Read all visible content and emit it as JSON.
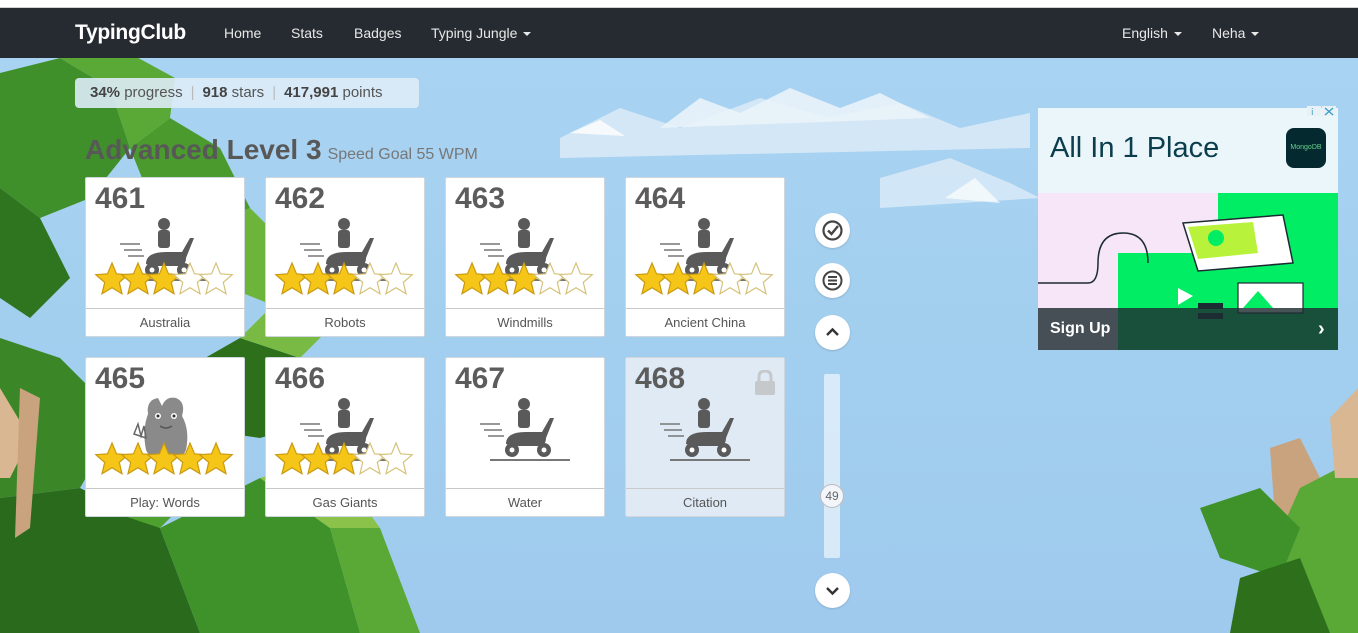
{
  "navbar": {
    "brand": "TypingClub",
    "links": [
      "Home",
      "Stats",
      "Badges",
      "Typing Jungle"
    ],
    "language": "English",
    "user": "Neha"
  },
  "progress": {
    "percent": "34%",
    "percent_label": "progress",
    "stars": "918",
    "stars_label": "stars",
    "points": "417,991",
    "points_label": "points"
  },
  "level": {
    "title": "Advanced Level 3",
    "speed_goal": "Speed Goal 55 WPM"
  },
  "lessons": [
    {
      "number": "461",
      "name": "Australia",
      "stars": 3,
      "type": "scooter",
      "locked": false
    },
    {
      "number": "462",
      "name": "Robots",
      "stars": 3,
      "type": "scooter",
      "locked": false
    },
    {
      "number": "463",
      "name": "Windmills",
      "stars": 3,
      "type": "scooter",
      "locked": false
    },
    {
      "number": "464",
      "name": "Ancient China",
      "stars": 3,
      "type": "scooter",
      "locked": false
    },
    {
      "number": "465",
      "name": "Play: Words",
      "stars": 5,
      "type": "monster",
      "locked": false
    },
    {
      "number": "466",
      "name": "Gas Giants",
      "stars": 3,
      "type": "scooter",
      "locked": false
    },
    {
      "number": "467",
      "name": "Water",
      "stars": 0,
      "type": "scooter",
      "locked": false
    },
    {
      "number": "468",
      "name": "Citation",
      "stars": 0,
      "type": "scooter",
      "locked": true
    }
  ],
  "sidebar": {
    "scroll_position": "49"
  },
  "ad": {
    "headline": "All In 1 Place",
    "logo_text": "MongoDB",
    "cta": "Sign Up",
    "cta_icon": "chevron-right-icon"
  },
  "colors": {
    "navbar": "#262b32",
    "sky": "#a3cfef",
    "star": "#f5c518",
    "ad_green": "#00ed64"
  }
}
